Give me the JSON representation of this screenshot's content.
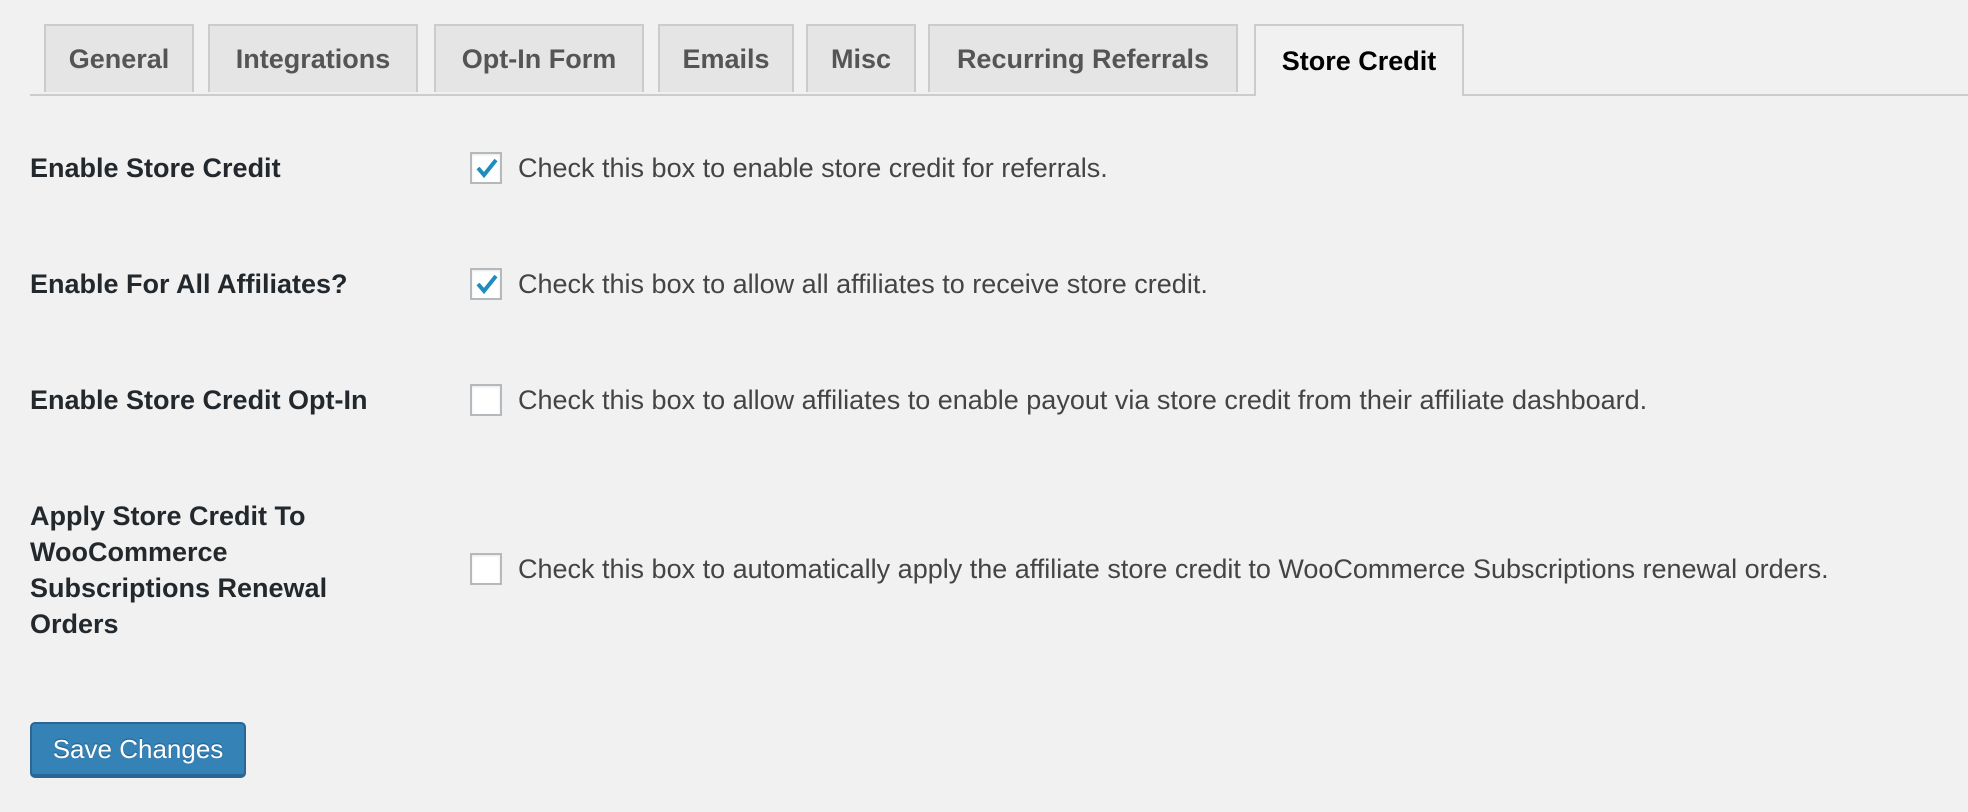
{
  "tabs": [
    {
      "label": "General",
      "active": false
    },
    {
      "label": "Integrations",
      "active": false
    },
    {
      "label": "Opt-In Form",
      "active": false
    },
    {
      "label": "Emails",
      "active": false
    },
    {
      "label": "Misc",
      "active": false
    },
    {
      "label": "Recurring Referrals",
      "active": false
    },
    {
      "label": "Store Credit",
      "active": true
    }
  ],
  "settings": [
    {
      "label": "Enable Store Credit",
      "checked": true,
      "description": "Check this box to enable store credit for referrals."
    },
    {
      "label": "Enable For All Affiliates?",
      "checked": true,
      "description": "Check this box to allow all affiliates to receive store credit."
    },
    {
      "label": "Enable Store Credit Opt-In",
      "checked": false,
      "description": "Check this box to allow affiliates to enable payout via store credit from their affiliate dashboard."
    },
    {
      "label_lines": [
        "Apply Store Credit To",
        "WooCommerce",
        "Subscriptions Renewal",
        "Orders"
      ],
      "checked": false,
      "description": "Check this box to automatically apply the affiliate store credit to WooCommerce Subscriptions renewal orders."
    }
  ],
  "save_button": {
    "label": "Save Changes"
  },
  "colors": {
    "accent": "#3582b6",
    "checkmark": "#1e8cbe"
  }
}
